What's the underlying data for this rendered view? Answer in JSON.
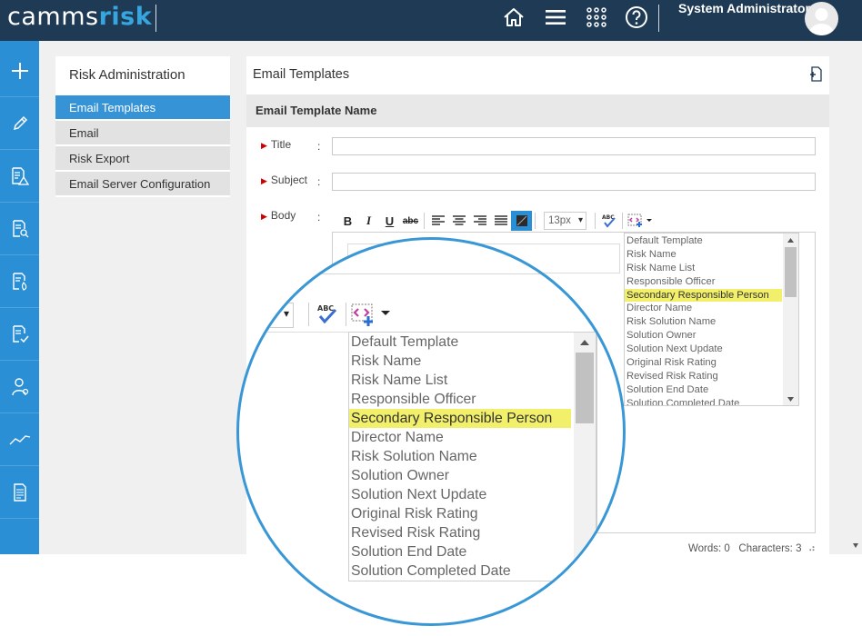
{
  "header": {
    "logo_part1": "camms",
    "logo_part2": "risk",
    "user_name": "System Administrator",
    "icons": [
      "home-icon",
      "menu-icon",
      "apps-grid-icon",
      "help-icon"
    ]
  },
  "rail": {
    "icons": [
      "plus-icon",
      "pencil-icon",
      "risk-register-icon",
      "search-doc-icon",
      "doc-fire-icon",
      "doc-check-icon",
      "person-icon",
      "trend-line-icon",
      "document-icon"
    ]
  },
  "left_panel": {
    "title": "Risk Administration",
    "items": [
      {
        "label": "Email Templates"
      },
      {
        "label": "Email"
      },
      {
        "label": "Risk Export"
      },
      {
        "label": "Email Server Configuration"
      }
    ]
  },
  "main": {
    "title": "Email Templates",
    "section_header": "Email Template Name",
    "fields": {
      "title_label": "Title",
      "subject_label": "Subject",
      "body_label": "Body",
      "colon": ":"
    },
    "toolbar": {
      "bold": "B",
      "italic": "I",
      "underline": "U",
      "strikethrough": "abc",
      "font_size": "13px",
      "spellcheck": "ABC"
    },
    "placeholders": [
      "Default Template",
      "Risk Name",
      "Risk Name List",
      "Responsible Officer",
      "Secondary Responsible Person",
      "Director Name",
      "Risk Solution Name",
      "Solution Owner",
      "Solution Next Update",
      "Original Risk Rating",
      "Revised Risk Rating",
      "Solution End Date",
      "Solution Completed Date"
    ],
    "highlighted_placeholder": "Secondary Responsible Person",
    "status": {
      "words_label": "Words:",
      "words_value": "0",
      "characters_label": "Characters:",
      "characters_value": "3"
    }
  },
  "colors": {
    "topbar": "#1f3a54",
    "rail": "#2a8fd4",
    "accent": "#3693d6",
    "highlight": "#f2f06a",
    "magnifier_border": "#3a97d6"
  }
}
